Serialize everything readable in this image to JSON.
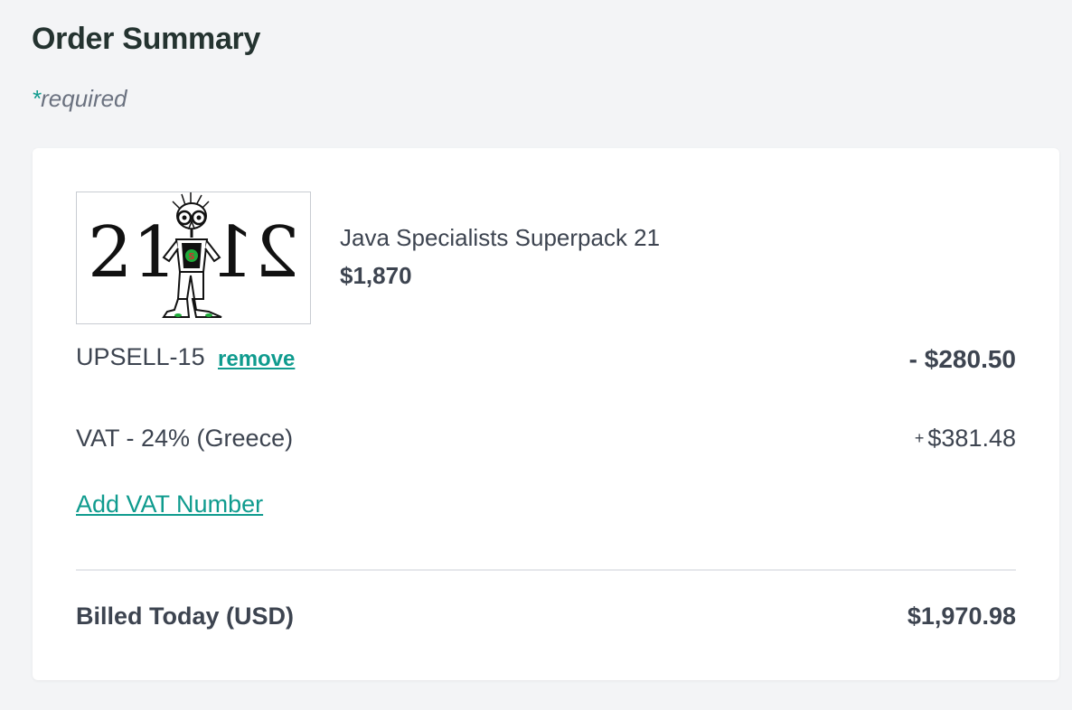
{
  "page": {
    "title": "Order Summary",
    "required_star": "*",
    "required_text": "required"
  },
  "product": {
    "image_alt": "Java Specialists Superpack 21 logo",
    "image_text_left": "21",
    "image_text_right": "21",
    "name": "Java Specialists Superpack 21",
    "price": "$1,870"
  },
  "coupon": {
    "code": "UPSELL-15",
    "remove_label": "remove",
    "discount": "- $280.50"
  },
  "vat": {
    "label": "VAT - 24% (Greece)",
    "sign": "+",
    "amount": "$381.48",
    "add_vat_label": "Add VAT Number"
  },
  "total": {
    "label": "Billed Today (USD)",
    "amount": "$1,970.98"
  },
  "colors": {
    "accent": "#0f9b8e",
    "text": "#3d4450",
    "background": "#f3f4f6",
    "card": "#ffffff"
  }
}
